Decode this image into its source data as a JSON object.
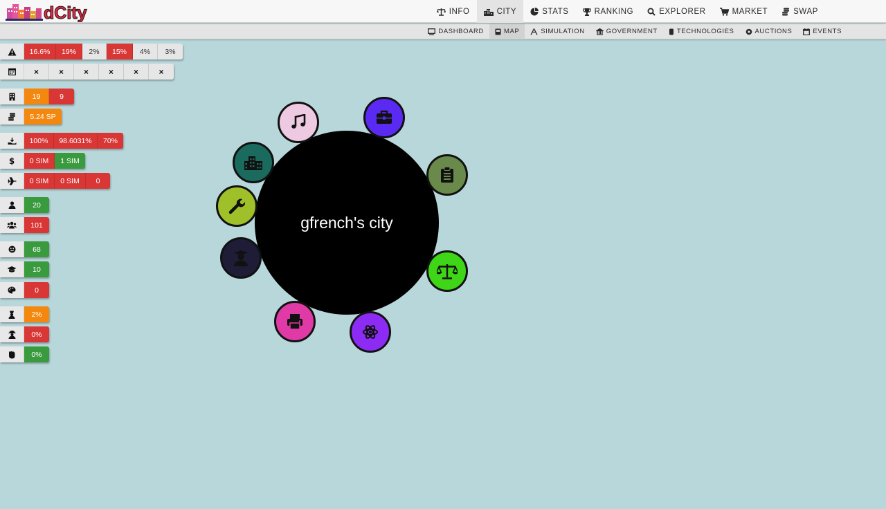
{
  "app": {
    "logo_text": "dCity"
  },
  "topnav": [
    {
      "label": "INFO",
      "icon": "scale-icon",
      "active": false
    },
    {
      "label": "CITY",
      "icon": "city-icon",
      "active": true
    },
    {
      "label": "STATS",
      "icon": "pie-chart-icon",
      "active": false
    },
    {
      "label": "RANKING",
      "icon": "trophy-icon",
      "active": false
    },
    {
      "label": "EXPLORER",
      "icon": "search-icon",
      "active": false
    },
    {
      "label": "MARKET",
      "icon": "cart-icon",
      "active": false
    },
    {
      "label": "SWAP",
      "icon": "coins-icon",
      "active": false
    }
  ],
  "subnav": [
    {
      "label": "DASHBOARD",
      "icon": "monitor-icon",
      "active": false
    },
    {
      "label": "MAP",
      "icon": "map-icon",
      "active": true
    },
    {
      "label": "SIMULATION",
      "icon": "simulation-icon",
      "active": false
    },
    {
      "label": "GOVERNMENT",
      "icon": "government-icon",
      "active": false
    },
    {
      "label": "TECHNOLOGIES",
      "icon": "technology-icon",
      "active": false
    },
    {
      "label": "AUCTIONS",
      "icon": "auction-icon",
      "active": false
    },
    {
      "label": "EVENTS",
      "icon": "calendar-icon",
      "active": false
    }
  ],
  "stats": {
    "warning": [
      "16.6%",
      "19%",
      "2%",
      "15%",
      "4%",
      "3%"
    ],
    "calendar": [
      "×",
      "×",
      "×",
      "×",
      "×",
      "×"
    ],
    "buildings": [
      "19",
      "9"
    ],
    "income": [
      "5.24 SP"
    ],
    "hand": [
      "100%",
      "98.6031%",
      "70%"
    ],
    "money": [
      "0 SIM",
      "1 SIM"
    ],
    "flights": [
      "0 SIM",
      "0 SIM",
      "0"
    ],
    "population": [
      "20"
    ],
    "group": [
      "101"
    ],
    "happiness": [
      "68"
    ],
    "education": [
      "10"
    ],
    "culture": [
      "0"
    ],
    "crime": [
      "2%"
    ],
    "unemployment": [
      "0%"
    ],
    "pollution": [
      "0%"
    ]
  },
  "city": {
    "name": "gfrench's city"
  },
  "colors": {
    "background": "#b8d7da",
    "red": "#d93636",
    "orange": "#f4880f",
    "green": "#3a9a3e",
    "music": "#eecae2",
    "business": "#5b2af2",
    "clipboard": "#6a8a4c",
    "justice": "#3ed616",
    "science": "#8b2bf3",
    "printing": "#e03aa6",
    "education": "#1e1c36",
    "tools": "#a0c02a",
    "industry": "#1a6b5e"
  }
}
